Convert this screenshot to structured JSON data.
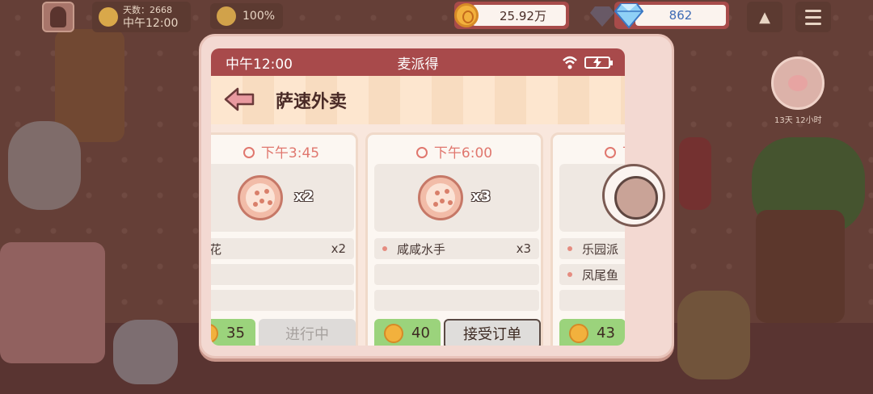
{
  "hud": {
    "time_prefix": "天数：2668",
    "time": "中午12:00",
    "mood": "100%",
    "coins": "25.92万",
    "gems": "862",
    "side_timer": "13天 12小时"
  },
  "phone": {
    "status_time": "中午12:00",
    "status_title": "麦派得",
    "app_title": "萨速外卖"
  },
  "orders": [
    {
      "time": "下午3:45",
      "qty_badge": "x2",
      "items": [
        {
          "name": "烟花",
          "qty": "x2"
        }
      ],
      "reward": "35",
      "action": "进行中",
      "action_state": "in-progress"
    },
    {
      "time": "下午6:00",
      "qty_badge": "x3",
      "items": [
        {
          "name": "咸咸水手",
          "qty": "x3"
        }
      ],
      "reward": "40",
      "action": "接受订单",
      "action_state": "accept"
    },
    {
      "time": "下",
      "items": [
        {
          "name": "乐园派"
        },
        {
          "name": "凤尾鱼"
        }
      ],
      "reward": "43"
    }
  ],
  "colors": {
    "status_bar": "#a84a4b",
    "card_time": "#e0776e",
    "reward_green": "#9bd37c",
    "gem_blue": "#3e6bb5"
  }
}
